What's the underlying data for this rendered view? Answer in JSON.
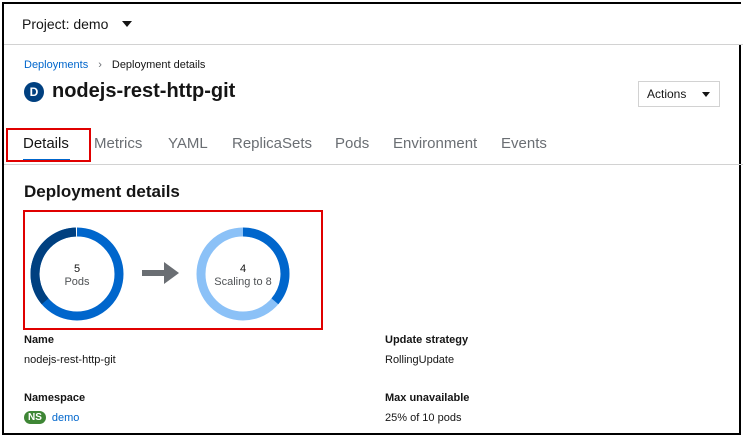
{
  "project": {
    "label": "Project: demo"
  },
  "breadcrumb": {
    "parent": "Deployments",
    "current": "Deployment details"
  },
  "resource": {
    "badge": "D",
    "name": "nodejs-rest-http-git"
  },
  "actions": {
    "label": "Actions"
  },
  "tabs": [
    {
      "label": "Details"
    },
    {
      "label": "Metrics"
    },
    {
      "label": "YAML"
    },
    {
      "label": "ReplicaSets"
    },
    {
      "label": "Pods"
    },
    {
      "label": "Environment"
    },
    {
      "label": "Events"
    }
  ],
  "section": {
    "title": "Deployment details"
  },
  "pods": {
    "current": {
      "count": "5",
      "label": "Pods"
    },
    "target": {
      "count": "4",
      "label": "Scaling to 8"
    }
  },
  "details": {
    "name": {
      "label": "Name",
      "value": "nodejs-rest-http-git"
    },
    "namespace": {
      "label": "Namespace",
      "badge": "NS",
      "value": "demo"
    },
    "update_strategy": {
      "label": "Update strategy",
      "value": "RollingUpdate"
    },
    "max_unavailable": {
      "label": "Max unavailable",
      "value": "25% of 10 pods"
    }
  },
  "colors": {
    "accent": "#0066cc",
    "dark_blue": "#004080",
    "light_blue": "#8bc1f7",
    "namespace_green": "#3e8635",
    "highlight_red": "#e00000"
  },
  "icons": {
    "arrow": "arrow-right-icon",
    "dropdown": "caret-down-icon"
  }
}
